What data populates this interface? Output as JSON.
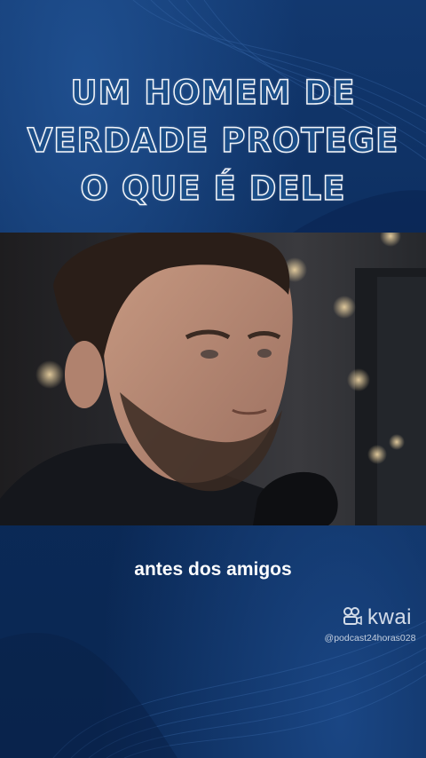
{
  "video": {
    "headline_lines": [
      "UM HOMEM DE",
      "VERDADE PROTEGE",
      "O QUE É DELE"
    ],
    "caption": "antes dos amigos",
    "image_description_icon": "man-portrait-photo"
  },
  "watermark": {
    "brand": "kwai",
    "icon": "kwai-logo-icon",
    "handle": "@podcast24horas028"
  },
  "colors": {
    "background": "#0d2c5c",
    "headline_fill": "#1b4e88",
    "headline_stroke": "#f4f6fa",
    "caption": "#ffffff"
  }
}
